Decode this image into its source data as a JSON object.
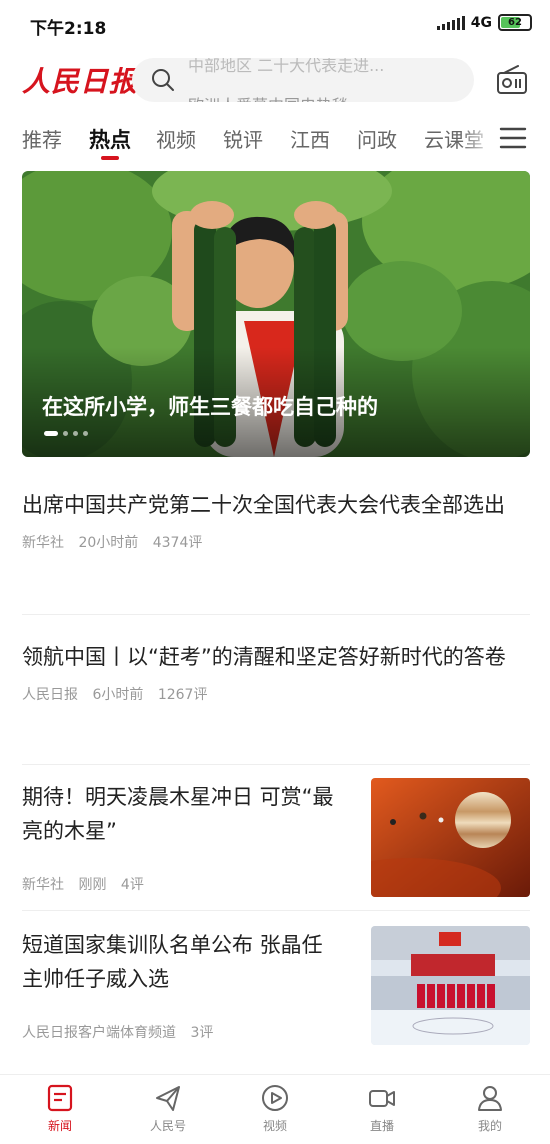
{
  "status_bar": {
    "time": "下午2:18",
    "network": "4G",
    "battery": "62"
  },
  "header": {
    "logo": "人民日报",
    "search_suggestion_top": "中部地区 二十大代表走进...",
    "search_suggestion_bottom": "欧洲人爱慕中国电热毯"
  },
  "tabs": [
    "推荐",
    "热点",
    "视频",
    "锐评",
    "江西",
    "问政",
    "云课堂"
  ],
  "active_tab": "热点",
  "banner": {
    "title": "在这所小学，师生三餐都吃自己种的",
    "slide_count": 4,
    "active_slide": 1
  },
  "articles": [
    {
      "title": "出席中国共产党第二十次全国代表大会代表全部选出",
      "source": "新华社",
      "time": "20小时前",
      "comments": "4374评"
    },
    {
      "title": "领航中国丨以“赶考”的清醒和坚定答好新时代的答卷",
      "source": "人民日报",
      "time": "6小时前",
      "comments": "1267评"
    },
    {
      "title": "期待！明天凌晨木星冲日 可赏“最亮的木星”",
      "source": "新华社",
      "time": "刚刚",
      "comments": "4评"
    },
    {
      "title": "短道国家集训队名单公布 张晶任主帅任子威入选",
      "source": "人民日报客户端体育频道",
      "time": "",
      "comments": "3评"
    }
  ],
  "bottom_nav": [
    "新闻",
    "人民号",
    "视频",
    "直播",
    "我的"
  ],
  "bottom_nav_active": "新闻",
  "colors": {
    "accent": "#d6141e",
    "tab_inactive": "#666666",
    "meta": "#999999"
  },
  "icons": [
    "search-icon",
    "radio-icon",
    "menu-icon",
    "news-icon",
    "send-icon",
    "play-icon",
    "live-camera-icon",
    "user-icon"
  ]
}
